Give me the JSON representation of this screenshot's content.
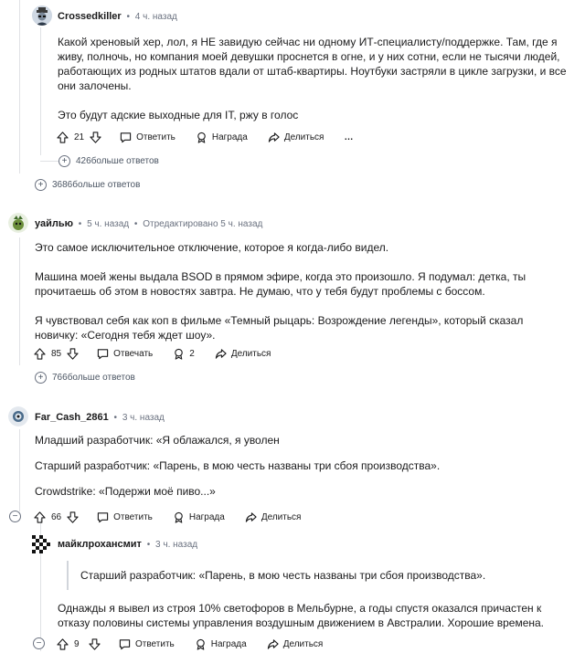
{
  "comments": [
    {
      "user": "Crossedkiller",
      "time": "4 ч. назад",
      "paragraphs": [
        "Какой хреновый хер, лол, я НЕ завидую сейчас ни одному ИТ-специалисту/поддержке. Там, где я живу, полночь, но компания моей девушки проснется в огне, и у них сотни, если не тысячи людей, работающих из родных штатов вдали от штаб-квартиры. Ноутбуки застряли в цикле загрузки, и все они залочены.",
        "Это будут адские выходные для IT, ржу в голос"
      ],
      "score": "21",
      "reply_label": "Ответить",
      "award_label": "Награда",
      "share_label": "Делиться",
      "more_icon": "…"
    },
    {
      "user": "уайлью",
      "time": "5 ч. назад",
      "edited": "Отредактировано 5 ч. назад",
      "paragraphs": [
        "Это самое исключительное отключение, которое я когда-либо видел.",
        "Машина моей жены выдала BSOD в прямом эфире, когда это произошло. Я подумал: детка, ты прочитаешь об этом в новостях завтра. Не думаю, что у тебя будут проблемы с боссом.",
        "Я чувствовал себя как коп в фильме «Темный рыцарь: Возрождение легенды», который сказал новичку: «Сегодня тебя ждет шоу»."
      ],
      "score": "85",
      "reply_label": "Отвечать",
      "award_count": "2",
      "share_label": "Делиться"
    },
    {
      "user": "Far_Cash_2861",
      "time": "3 ч. назад",
      "paragraphs": [
        "Младший разработчик: «Я облажался, я уволен",
        "Старший разработчик: «Парень, в мою честь названы три сбоя производства».",
        "Crowdstrike: «Подержи моё пиво...»"
      ],
      "score": "66",
      "reply_label": "Ответить",
      "award_label": "Награда",
      "share_label": "Делиться"
    },
    {
      "user": "майклрохансмит",
      "time": "3 ч. назад",
      "quote": "Старший разработчик: «Парень, в мою честь названы три сбоя производства».",
      "paragraphs": [
        "Однажды я вывел из строя 10% светофоров в Мельбурне, а годы спустя оказался причастен к отказу половины системы управления воздушным движением в Австралии. Хорошие времена."
      ],
      "score": "9",
      "reply_label": "Ответить",
      "award_label": "Награда",
      "share_label": "Делиться"
    }
  ],
  "more_replies": [
    {
      "count": "426",
      "label": "больше ответов"
    },
    {
      "count": "3686",
      "label": "больше ответов"
    },
    {
      "count": "766",
      "label": "больше ответов"
    }
  ],
  "colors": {
    "text": "#1a1a1b",
    "muted": "#6b7280",
    "thread": "#e0e2e5"
  }
}
